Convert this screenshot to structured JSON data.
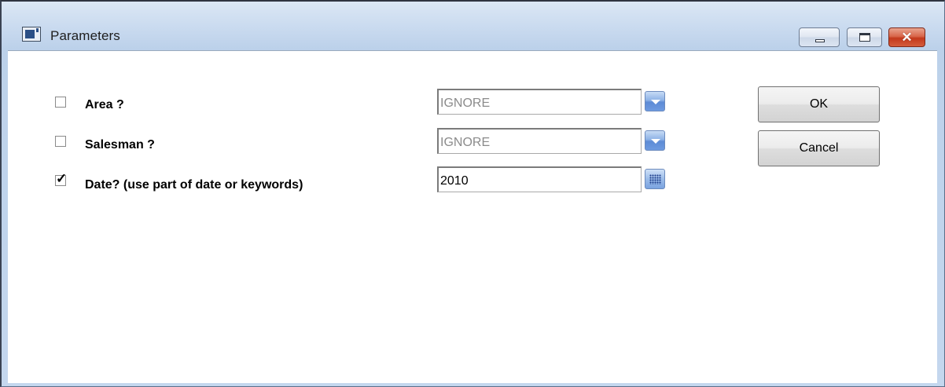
{
  "window": {
    "title": "Parameters",
    "close_glyph": "✕"
  },
  "params": [
    {
      "label": "Area ?",
      "checked": false,
      "value": "IGNORE",
      "picker": "dropdown-arrow-icon",
      "enabled": false
    },
    {
      "label": "Salesman ?",
      "checked": false,
      "value": "IGNORE",
      "picker": "dropdown-arrow-icon",
      "enabled": false
    },
    {
      "label": "Date? (use part of date or keywords)",
      "checked": true,
      "value": "2010",
      "picker": "calendar-icon",
      "enabled": true
    }
  ],
  "check_glyph": "✓",
  "buttons": {
    "ok": "OK",
    "cancel": "Cancel"
  },
  "colors": {
    "title_bar": "#c9daef",
    "disabled_text": "#8b8b8b",
    "picker_button": "#5d8bd6",
    "close_button": "#c3391c"
  }
}
